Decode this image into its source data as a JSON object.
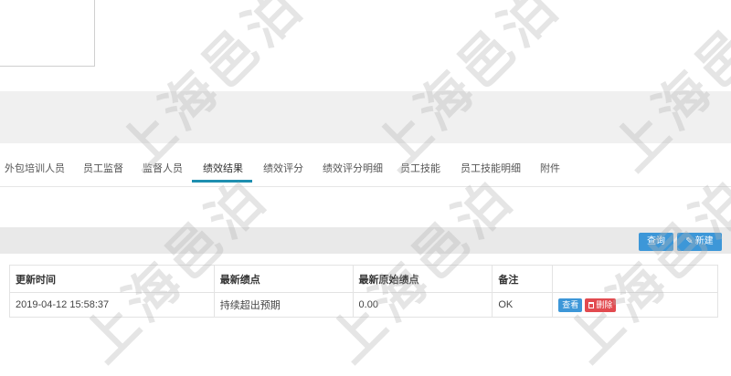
{
  "tabs": [
    {
      "label": "外包培训人员"
    },
    {
      "label": "员工监督"
    },
    {
      "label": "监督人员"
    },
    {
      "label": "绩效结果"
    },
    {
      "label": "绩效评分"
    },
    {
      "label": "绩效评分明细"
    },
    {
      "label": "员工技能"
    },
    {
      "label": "员工技能明细"
    },
    {
      "label": "附件"
    }
  ],
  "active_tab": "绩效结果",
  "toolbar": {
    "query_label": "查询",
    "new_label": "新建"
  },
  "table": {
    "headers": [
      "更新时间",
      "最新绩点",
      "最新原始绩点",
      "备注",
      ""
    ],
    "rows": [
      {
        "updated": "2019-04-12 15:58:37",
        "latest_grade": "持续超出预期",
        "raw_grade": "0.00",
        "note": "OK",
        "view_label": "查看",
        "delete_label": "删除"
      }
    ]
  },
  "watermark_text": "上海邑泊",
  "colors": {
    "accent": "#1e8fb0",
    "primary_button": "#3d97d8",
    "danger_button": "#e24a4f"
  },
  "icons": {
    "new": "pencil-icon",
    "delete": "trash-icon"
  }
}
